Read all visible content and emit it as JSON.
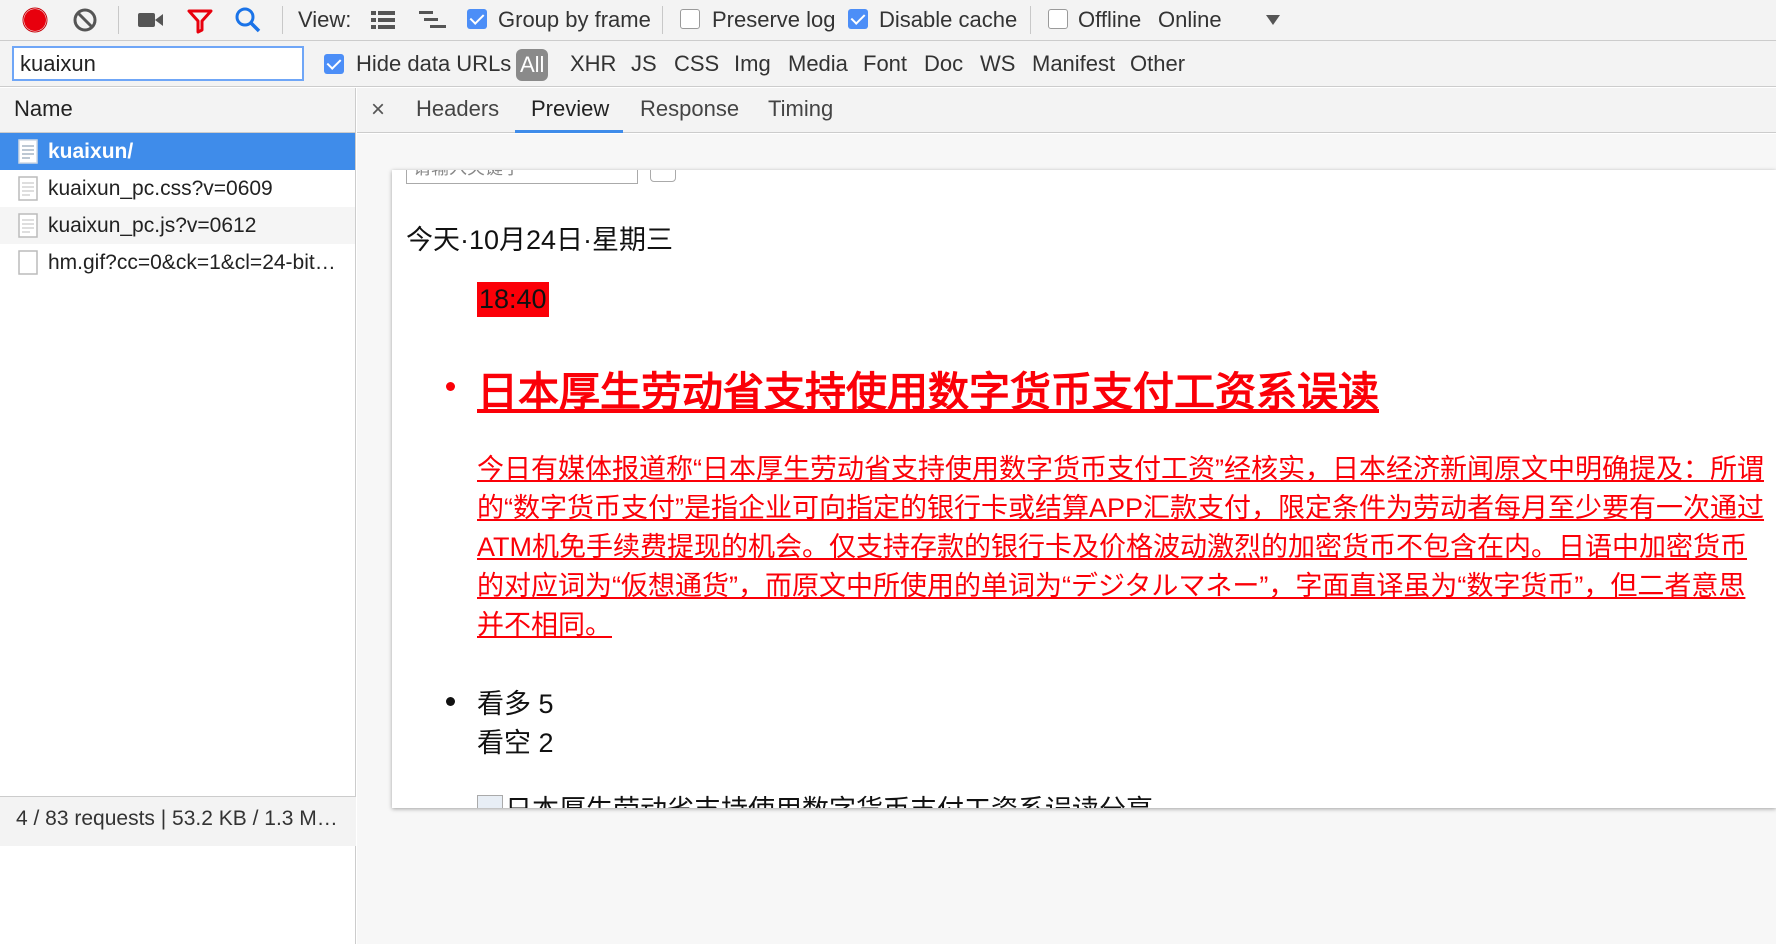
{
  "toolbar": {
    "view_label": "View:",
    "group_by_frame": "Group by frame",
    "preserve_log": "Preserve log",
    "disable_cache": "Disable cache",
    "offline": "Offline",
    "throttle_value": "Online",
    "group_by_frame_checked": true,
    "preserve_log_checked": false,
    "disable_cache_checked": true,
    "offline_checked": false,
    "record_color": "#e8000d",
    "filter_icon_color": "#e8000d",
    "search_icon_color": "#1a73e8"
  },
  "filter": {
    "value": "kuaixun",
    "hide_data_urls": "Hide data URLs",
    "hide_data_urls_checked": true,
    "types": [
      "All",
      "XHR",
      "JS",
      "CSS",
      "Img",
      "Media",
      "Font",
      "Doc",
      "WS",
      "Manifest",
      "Other"
    ],
    "active_type": "All"
  },
  "requests": {
    "header": "Name",
    "items": [
      {
        "name": "kuaixun/",
        "selected": true
      },
      {
        "name": "kuaixun_pc.css?v=0609",
        "selected": false
      },
      {
        "name": "kuaixun_pc.js?v=0612",
        "selected": false
      },
      {
        "name": "hm.gif?cc=0&ck=1&cl=24-bit…",
        "selected": false
      }
    ],
    "status": "4 / 83 requests | 53.2 KB / 1.3 M…"
  },
  "detail_tabs": {
    "items": [
      "Headers",
      "Preview",
      "Response",
      "Timing"
    ],
    "active": "Preview"
  },
  "preview": {
    "search_placeholder": "请输入关键字",
    "date": "今天·10月24日·星期三",
    "time": "18:40",
    "headline": "日本厚生劳动省支持使用数字货币支付工资系误读",
    "summary": "今日有媒体报道称“日本厚生劳动省支持使用数字货币支付工资”经核实，日本经济新闻原文中明确提及：所谓的“数字货币支付”是指企业可向指定的银行卡或结算APP汇款支付，限定条件为劳动者每月至少要有一次通过ATM机免手续费提现的机会。仅支持存款的银行卡及价格波动激烈的加密货币不包含在内。日语中加密货币的对应词为“仮想通货”，而原文中所使用的单词为“デジタルマネー”，字面直译虽为“数字货币”，但二者意思并不相同。",
    "bullish": "看多 5",
    "bearish": "看空 2",
    "share_text": "日本厚生劳动省支持使用数字货币支付工资系误读分享",
    "accent_red": "#fb0008",
    "selected_blue": "#3f8cea"
  }
}
